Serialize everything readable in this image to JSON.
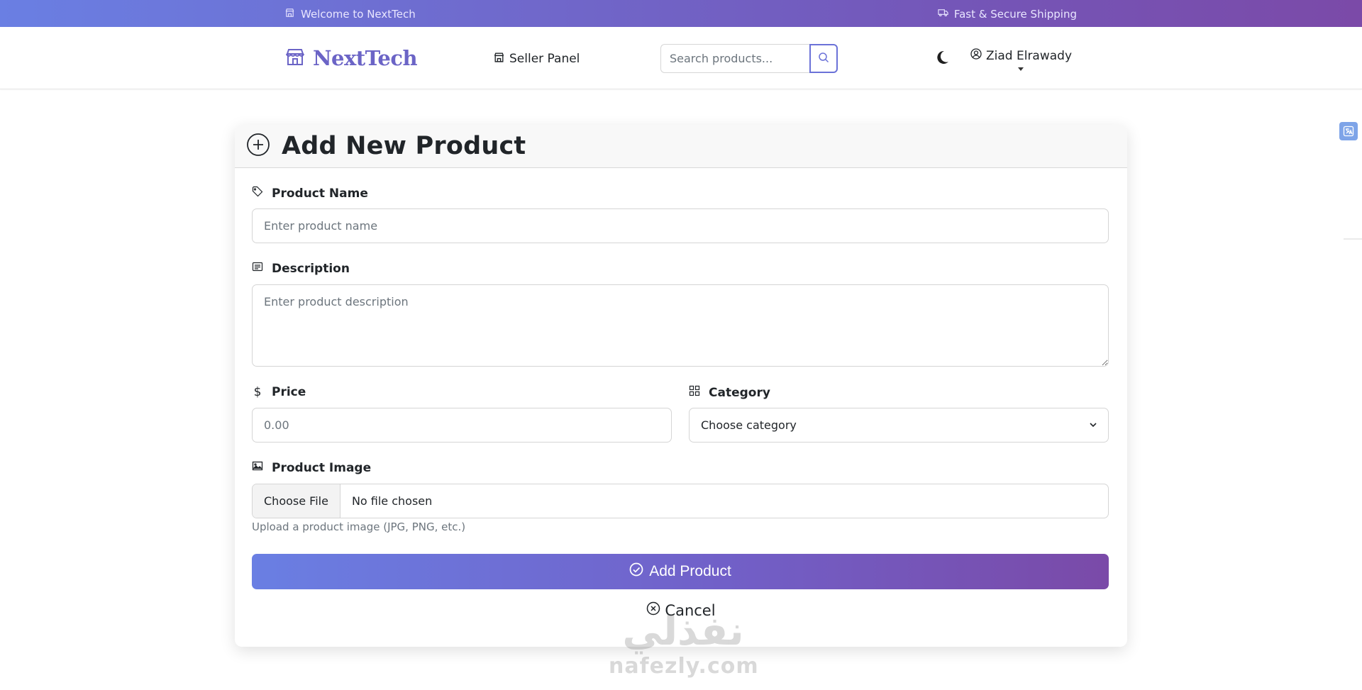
{
  "topbar": {
    "welcome": "Welcome to NextTech",
    "shipping": "Fast & Secure Shipping"
  },
  "navbar": {
    "brand": "NextTech",
    "seller_panel": "Seller Panel",
    "search_placeholder": "Search products...",
    "user_name": "Ziad Elrawady"
  },
  "form": {
    "title": "Add New Product",
    "product_name_label": "Product Name",
    "product_name_placeholder": "Enter product name",
    "description_label": "Description",
    "description_placeholder": "Enter product description",
    "price_label": "Price",
    "price_placeholder": "0.00",
    "category_label": "Category",
    "category_selected": "Choose category",
    "image_label": "Product Image",
    "choose_file": "Choose File",
    "file_status": "No file chosen",
    "image_hint": "Upload a product image (JPG, PNG, etc.)",
    "submit_label": "Add Product",
    "cancel_label": "Cancel"
  },
  "watermark": {
    "arabic": "نفذلي",
    "latin": "nafezly.com"
  },
  "colors": {
    "gradient_start": "#6a7fe3",
    "gradient_end": "#7a4aa8",
    "brand": "#6b64c6"
  },
  "icons": {
    "store": "store-icon",
    "truck": "truck-icon",
    "search": "search-icon",
    "moon": "moon-icon",
    "user": "user-circle-icon",
    "translate": "translate-icon"
  }
}
